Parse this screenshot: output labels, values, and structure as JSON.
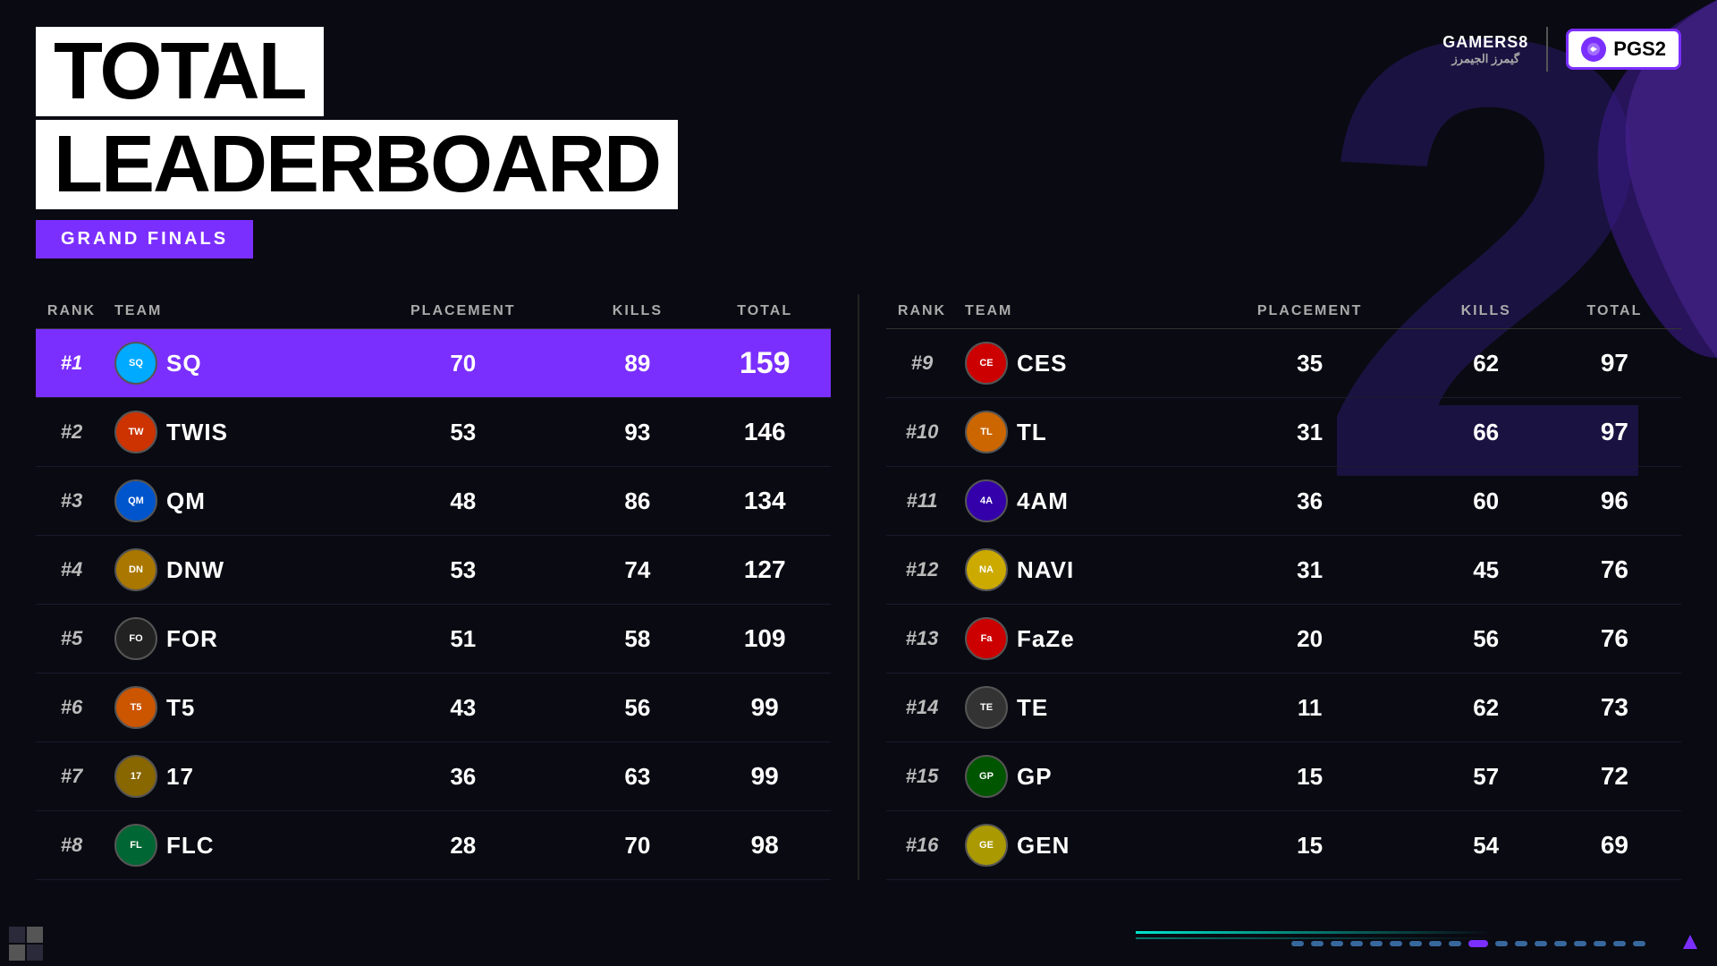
{
  "background": {
    "number": "2",
    "color": "#0a0a12"
  },
  "header": {
    "title_line1": "TOTAL",
    "title_line2": "LEADERBOARD",
    "subtitle": "GRAND FINALS"
  },
  "logos": {
    "gamers8_line1": "GAMERS8",
    "gamers8_line2": "گيمرز الجيمرز",
    "pgs2": "PGS2"
  },
  "table_headers": {
    "rank": "RANK",
    "team": "TEAM",
    "placement": "PLACEMENT",
    "kills": "KILLS",
    "total": "TOTAL"
  },
  "left_table": [
    {
      "rank": "#1",
      "team": "SQ",
      "logo_class": "logo-sq",
      "placement": "70",
      "kills": "89",
      "total": "159",
      "first_place": true
    },
    {
      "rank": "#2",
      "team": "TWIS",
      "logo_class": "logo-twis",
      "placement": "53",
      "kills": "93",
      "total": "146",
      "first_place": false
    },
    {
      "rank": "#3",
      "team": "QM",
      "logo_class": "logo-qm",
      "placement": "48",
      "kills": "86",
      "total": "134",
      "first_place": false
    },
    {
      "rank": "#4",
      "team": "DNW",
      "logo_class": "logo-dnw",
      "placement": "53",
      "kills": "74",
      "total": "127",
      "first_place": false
    },
    {
      "rank": "#5",
      "team": "FOR",
      "logo_class": "logo-for",
      "placement": "51",
      "kills": "58",
      "total": "109",
      "first_place": false
    },
    {
      "rank": "#6",
      "team": "T5",
      "logo_class": "logo-t5",
      "placement": "43",
      "kills": "56",
      "total": "99",
      "first_place": false
    },
    {
      "rank": "#7",
      "team": "17",
      "logo_class": "logo-17",
      "placement": "36",
      "kills": "63",
      "total": "99",
      "first_place": false
    },
    {
      "rank": "#8",
      "team": "FLC",
      "logo_class": "logo-flc",
      "placement": "28",
      "kills": "70",
      "total": "98",
      "first_place": false
    }
  ],
  "right_table": [
    {
      "rank": "#9",
      "team": "CES",
      "logo_class": "logo-ces",
      "placement": "35",
      "kills": "62",
      "total": "97"
    },
    {
      "rank": "#10",
      "team": "TL",
      "logo_class": "logo-tl",
      "placement": "31",
      "kills": "66",
      "total": "97"
    },
    {
      "rank": "#11",
      "team": "4AM",
      "logo_class": "logo-4am",
      "placement": "36",
      "kills": "60",
      "total": "96"
    },
    {
      "rank": "#12",
      "team": "NAVI",
      "logo_class": "logo-navi",
      "placement": "31",
      "kills": "45",
      "total": "76"
    },
    {
      "rank": "#13",
      "team": "FaZe",
      "logo_class": "logo-faze",
      "placement": "20",
      "kills": "56",
      "total": "76"
    },
    {
      "rank": "#14",
      "team": "TE",
      "logo_class": "logo-te",
      "placement": "11",
      "kills": "62",
      "total": "73"
    },
    {
      "rank": "#15",
      "team": "GP",
      "logo_class": "logo-gp",
      "placement": "15",
      "kills": "57",
      "total": "72"
    },
    {
      "rank": "#16",
      "team": "GEN",
      "logo_class": "logo-gen",
      "placement": "15",
      "kills": "54",
      "total": "69"
    }
  ],
  "pagination_dots": 18,
  "active_dot": 9
}
